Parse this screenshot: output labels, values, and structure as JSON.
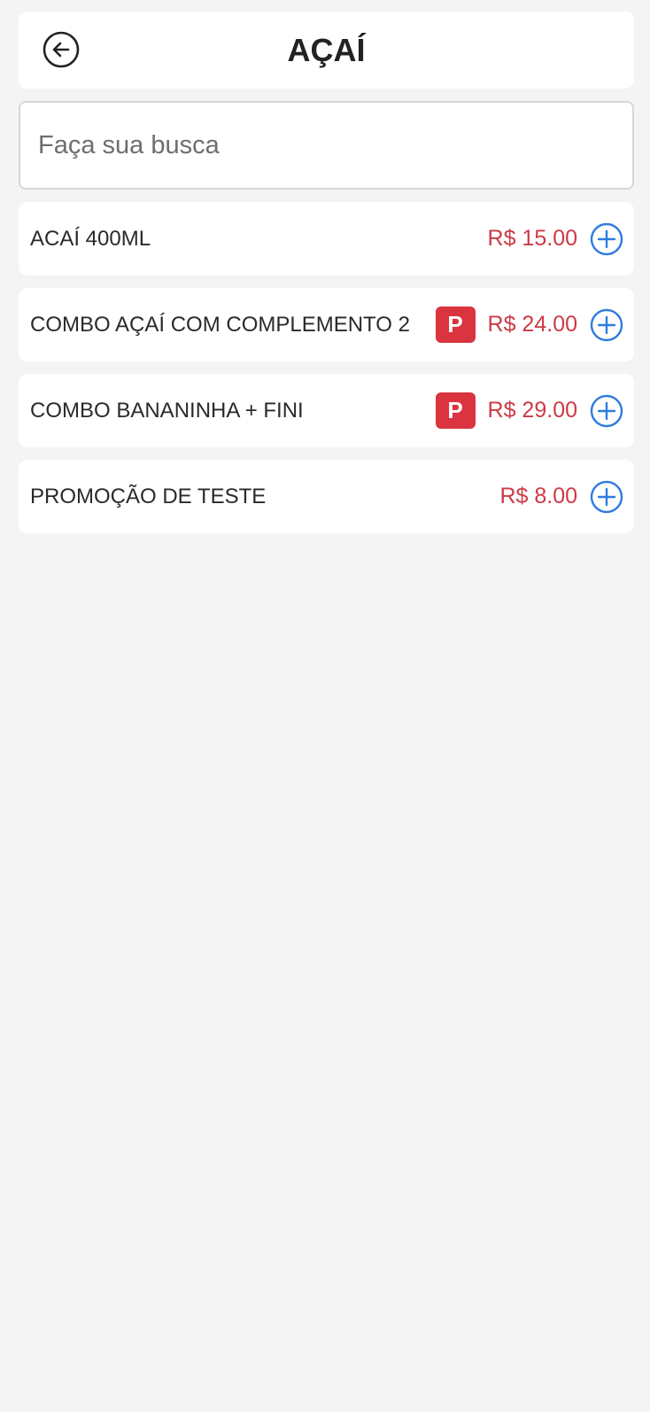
{
  "header": {
    "title": "AÇAÍ",
    "back_icon": "arrow-left-circle-icon"
  },
  "search": {
    "placeholder": "Faça sua busca",
    "value": ""
  },
  "items": [
    {
      "name": "ACAÍ 400ML",
      "badge": "",
      "price": "R$ 15.00"
    },
    {
      "name": "COMBO AÇAÍ COM COMPLEMENTO 2",
      "badge": "P",
      "price": "R$ 24.00"
    },
    {
      "name": "COMBO BANANINHA + FINI",
      "badge": "P",
      "price": "R$ 29.00"
    },
    {
      "name": "PROMOÇÃO DE TESTE",
      "badge": "",
      "price": "R$ 8.00"
    }
  ],
  "colors": {
    "background": "#f4f4f4",
    "price": "#cc3a46",
    "badge": "#d9343f",
    "add_icon": "#2f7be0"
  }
}
